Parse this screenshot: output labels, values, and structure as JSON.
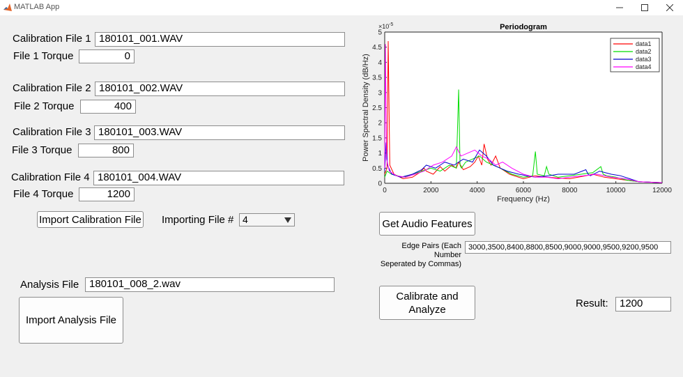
{
  "window": {
    "title": "MATLAB App"
  },
  "calibration": [
    {
      "label": "Calibration File 1",
      "file": "180101_001.WAV",
      "torque_label": "File 1 Torque",
      "torque": "0"
    },
    {
      "label": "Calibration File 2",
      "file": "180101_002.WAV",
      "torque_label": "File 2 Torque",
      "torque": "400"
    },
    {
      "label": "Calibration File 3",
      "file": "180101_003.WAV",
      "torque_label": "File 3 Torque",
      "torque": "800"
    },
    {
      "label": "Calibration File 4",
      "file": "180101_004.WAV",
      "torque_label": "File 4 Torque",
      "torque": "1200"
    }
  ],
  "import_calibration": {
    "button": "Import Calibration File",
    "importing_label": "Importing File #",
    "selected": "4"
  },
  "analysis": {
    "label": "Analysis File",
    "file": "180101_008_2.wav",
    "button": "Import Analysis File"
  },
  "audio": {
    "button": "Get Audio Features"
  },
  "edge": {
    "label_line1": "Edge Pairs (Each Number",
    "label_line2": "Seperated by Commas)",
    "value": "3000,3500,8400,8800,8500,9000,9000,9500,9200,9500"
  },
  "calibrate": {
    "line1": "Calibrate and",
    "line2": "Analyze"
  },
  "result": {
    "label": "Result:",
    "value": "1200"
  },
  "chart_data": {
    "type": "line",
    "title": "Periodogram",
    "xlabel": "Frequency (Hz)",
    "ylabel": "Power Spectral Density (dB/Hz)",
    "y_exponent": "×10",
    "y_exponent_power": "-5",
    "xlim": [
      0,
      12000
    ],
    "ylim": [
      0,
      5
    ],
    "x_ticks": [
      "0",
      "2000",
      "4000",
      "6000",
      "8000",
      "10000",
      "12000"
    ],
    "y_ticks": [
      "0",
      "0.5",
      "1",
      "1.5",
      "2",
      "2.5",
      "3",
      "3.5",
      "4",
      "4.5",
      "5"
    ],
    "legend_position": "top-right",
    "series": [
      {
        "name": "data1",
        "color": "#ff0000",
        "x": [
          0,
          100,
          150,
          220,
          400,
          800,
          1200,
          1500,
          1700,
          1800,
          2100,
          2400,
          2600,
          2900,
          3100,
          3200,
          3400,
          3700,
          3900,
          4050,
          4200,
          4300,
          4450,
          4600,
          4800,
          5000,
          5200,
          5400,
          6000,
          6500,
          7000,
          8000,
          8700,
          9000,
          9500,
          10000,
          10500,
          11000,
          12000
        ],
        "y": [
          0.3,
          0.5,
          4.7,
          0.6,
          0.3,
          0.15,
          0.2,
          0.35,
          0.5,
          0.4,
          0.3,
          0.55,
          0.4,
          0.6,
          0.5,
          0.7,
          0.45,
          0.55,
          0.7,
          0.9,
          0.6,
          1.3,
          0.8,
          0.6,
          0.9,
          0.5,
          0.4,
          0.3,
          0.15,
          0.25,
          0.2,
          0.15,
          0.25,
          0.3,
          0.2,
          0.15,
          0.1,
          0.05,
          0.02
        ]
      },
      {
        "name": "data2",
        "color": "#00dd00",
        "x": [
          0,
          100,
          300,
          800,
          1200,
          1600,
          2000,
          2400,
          2800,
          3100,
          3200,
          3260,
          3320,
          3500,
          3800,
          4100,
          4400,
          4700,
          5000,
          5500,
          6000,
          6400,
          6520,
          6600,
          6900,
          7000,
          7100,
          7500,
          8000,
          8500,
          9000,
          9350,
          9450,
          9600,
          10000,
          10500,
          11000,
          12000
        ],
        "y": [
          0.2,
          0.4,
          0.3,
          0.2,
          0.3,
          0.4,
          0.5,
          0.4,
          0.6,
          0.5,
          3.1,
          0.6,
          0.5,
          0.7,
          0.8,
          0.9,
          0.7,
          0.6,
          0.5,
          0.3,
          0.2,
          0.25,
          1.05,
          0.3,
          0.25,
          0.55,
          0.3,
          0.2,
          0.25,
          0.3,
          0.35,
          0.55,
          0.3,
          0.25,
          0.2,
          0.1,
          0.05,
          0.02
        ]
      },
      {
        "name": "data3",
        "color": "#0000cc",
        "x": [
          0,
          60,
          120,
          300,
          700,
          1200,
          1600,
          1800,
          2200,
          2600,
          3000,
          3400,
          3800,
          4100,
          4400,
          4700,
          5000,
          5300,
          5800,
          6500,
          7100,
          7500,
          8200,
          8700,
          8800,
          8900,
          9300,
          9800,
          10200,
          10600,
          11000,
          12000
        ],
        "y": [
          0.4,
          1.35,
          0.6,
          0.3,
          0.2,
          0.3,
          0.45,
          0.6,
          0.5,
          0.7,
          0.6,
          0.8,
          0.7,
          1.1,
          0.9,
          0.6,
          0.5,
          0.4,
          0.3,
          0.2,
          0.25,
          0.3,
          0.3,
          0.45,
          0.3,
          0.25,
          0.4,
          0.3,
          0.25,
          0.15,
          0.05,
          0.02
        ]
      },
      {
        "name": "data4",
        "color": "#ff00ff",
        "x": [
          0,
          30,
          80,
          200,
          500,
          900,
          1300,
          1700,
          2100,
          2500,
          2900,
          3100,
          3300,
          3600,
          3900,
          4200,
          4500,
          4800,
          5100,
          5500,
          6000,
          6500,
          7000,
          7500,
          8000,
          8600,
          9200,
          9800,
          10400,
          11000,
          12000
        ],
        "y": [
          0.5,
          4.6,
          0.8,
          0.4,
          0.25,
          0.2,
          0.3,
          0.4,
          0.6,
          0.7,
          0.9,
          1.2,
          0.9,
          1.0,
          1.1,
          0.9,
          0.8,
          0.6,
          0.7,
          0.5,
          0.3,
          0.2,
          0.2,
          0.15,
          0.2,
          0.25,
          0.3,
          0.2,
          0.15,
          0.05,
          0.02
        ]
      }
    ]
  }
}
